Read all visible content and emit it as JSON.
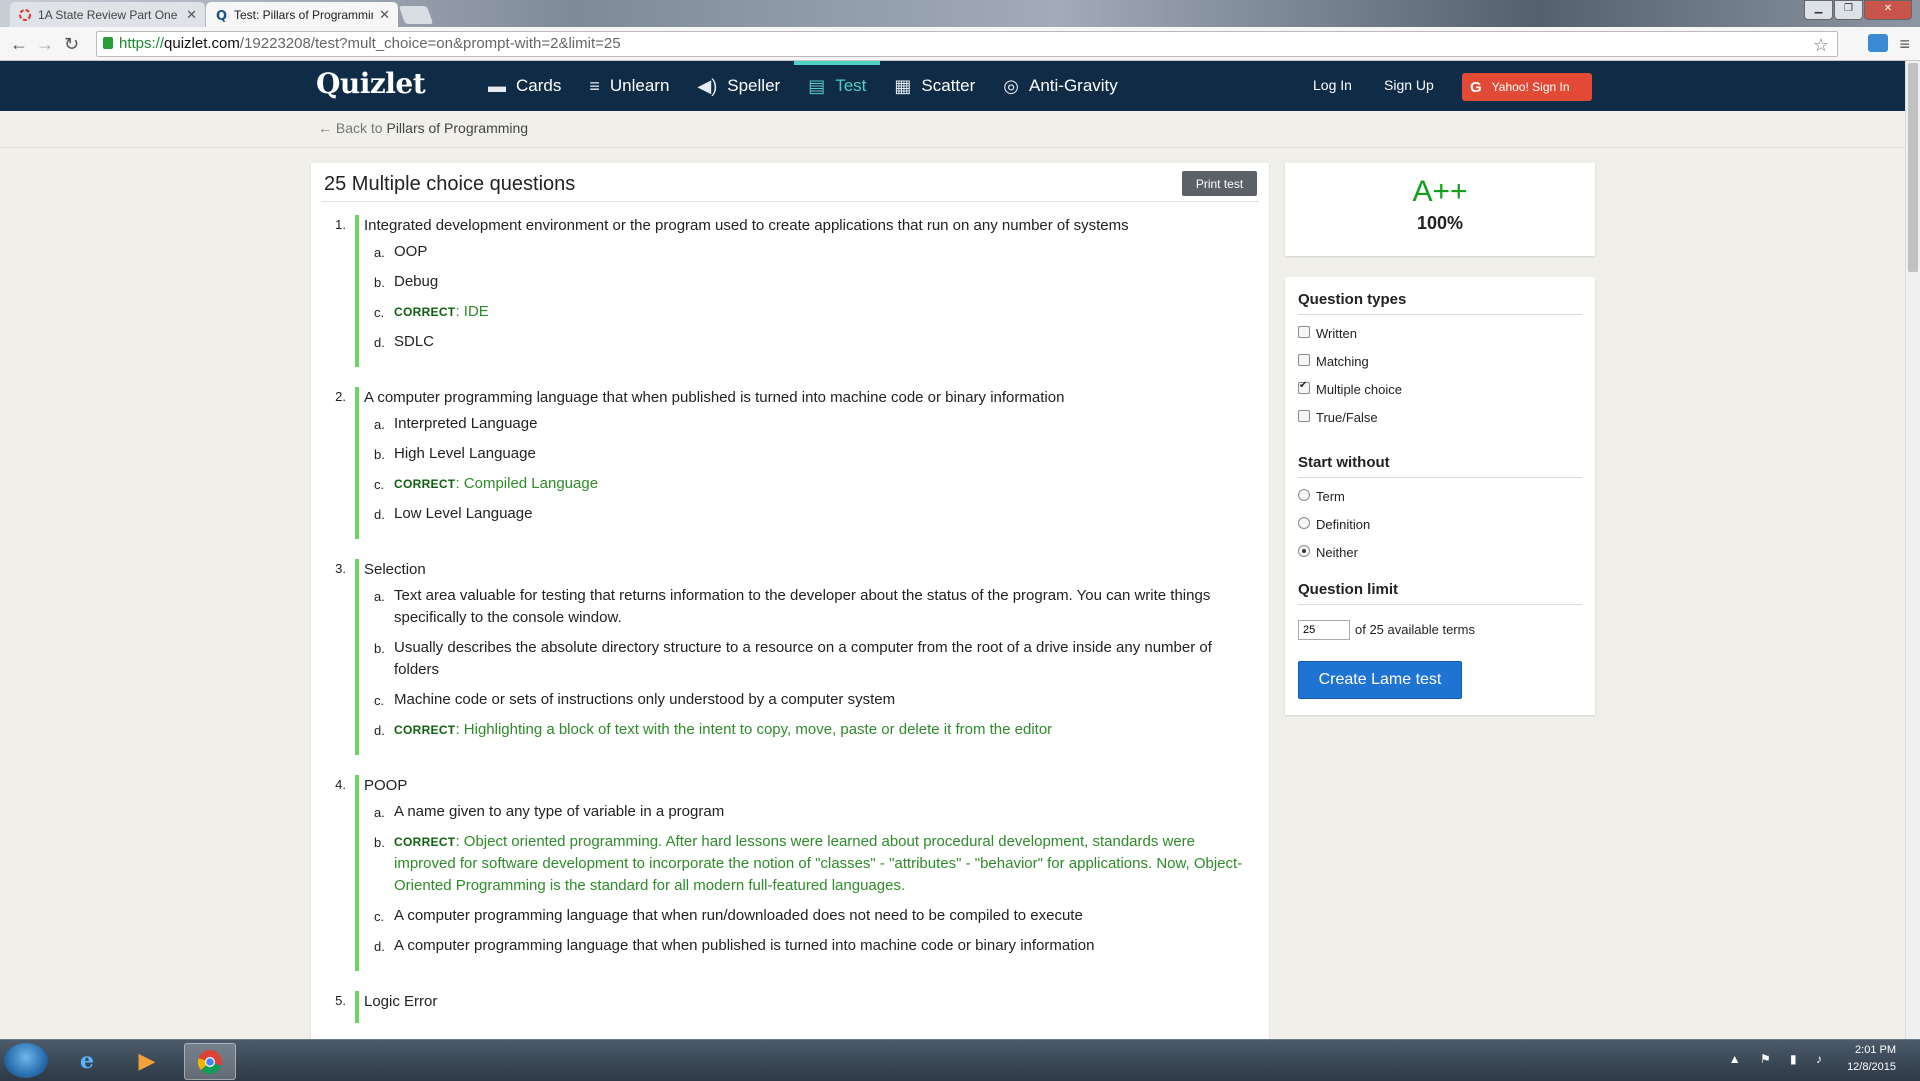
{
  "browser": {
    "tabs": [
      {
        "title": "1A State Review Part One",
        "active": false
      },
      {
        "title": "Test: Pillars of Programming",
        "active": true
      }
    ],
    "url_scheme": "https://",
    "url_host": "quizlet.com",
    "url_path": "/19223208/test?mult_choice=on&prompt-with=2&limit=25"
  },
  "header": {
    "logo": "Quizlet",
    "modes": [
      {
        "label": "Cards",
        "icon": "cards-icon",
        "glyph": "▬"
      },
      {
        "label": "Unlearn",
        "icon": "learn-icon",
        "glyph": "≡"
      },
      {
        "label": "Speller",
        "icon": "speaker-icon",
        "glyph": "◀)"
      },
      {
        "label": "Test",
        "icon": "test-icon",
        "glyph": "▤"
      },
      {
        "label": "Scatter",
        "icon": "scatter-icon",
        "glyph": "▦"
      },
      {
        "label": "Anti-Gravity",
        "icon": "planet-icon",
        "glyph": "◎"
      }
    ],
    "active_mode": "Test",
    "login": "Log In",
    "signup": "Sign Up",
    "yahoo": "Yahoo! Sign In",
    "yahoo_glyph": "G"
  },
  "subnav": {
    "back_prefix": "← Back to",
    "set_name": "Pillars of Programming"
  },
  "test": {
    "title": "25 Multiple choice questions",
    "print_label": "Print test",
    "correct_tag": "CORRECT",
    "questions": [
      {
        "num": "1.",
        "prompt": "Integrated development environment or the program used to create applications that run on any number of systems",
        "options": [
          {
            "letter": "a.",
            "text": "OOP",
            "correct": false
          },
          {
            "letter": "b.",
            "text": "Debug",
            "correct": false
          },
          {
            "letter": "c.",
            "text": "IDE",
            "correct": true
          },
          {
            "letter": "d.",
            "text": "SDLC",
            "correct": false
          }
        ]
      },
      {
        "num": "2.",
        "prompt": "A computer programming language that when published is turned into machine code or binary information",
        "options": [
          {
            "letter": "a.",
            "text": "Interpreted Language",
            "correct": false
          },
          {
            "letter": "b.",
            "text": "High Level Language",
            "correct": false
          },
          {
            "letter": "c.",
            "text": "Compiled Language",
            "correct": true
          },
          {
            "letter": "d.",
            "text": "Low Level Language",
            "correct": false
          }
        ]
      },
      {
        "num": "3.",
        "prompt": "Selection",
        "options": [
          {
            "letter": "a.",
            "text": "Text area valuable for testing that returns information to the developer about the status of the program. You can write things specifically to the console window.",
            "correct": false
          },
          {
            "letter": "b.",
            "text": "Usually describes the absolute directory structure to a resource on a computer from the root of a drive inside any number of folders",
            "correct": false
          },
          {
            "letter": "c.",
            "text": "Machine code or sets of instructions only understood by a computer system",
            "correct": false
          },
          {
            "letter": "d.",
            "text": "Highlighting a block of text with the intent to copy, move, paste or delete it from the editor",
            "correct": true
          }
        ]
      },
      {
        "num": "4.",
        "prompt": "POOP",
        "options": [
          {
            "letter": "a.",
            "text": "A name given to any type of variable in a program",
            "correct": false
          },
          {
            "letter": "b.",
            "text": "Object oriented programming. After hard lessons were learned about procedural development, standards were improved for software development to incorporate the notion of \"classes\" - \"attributes\" - \"behavior\" for applications. Now, Object-Oriented Programming is the standard for all modern full-featured languages.",
            "correct": true
          },
          {
            "letter": "c.",
            "text": "A computer programming language that when run/downloaded does not need to be compiled to execute",
            "correct": false
          },
          {
            "letter": "d.",
            "text": "A computer programming language that when published is turned into machine code or binary information",
            "correct": false
          }
        ]
      },
      {
        "num": "5.",
        "prompt": "Logic Error",
        "options": []
      }
    ]
  },
  "score": {
    "grade": "A++",
    "percent": "100%"
  },
  "options_panel": {
    "question_types_heading": "Question types",
    "question_types": [
      {
        "label": "Written",
        "checked": false
      },
      {
        "label": "Matching",
        "checked": false
      },
      {
        "label": "Multiple choice",
        "checked": true
      },
      {
        "label": "True/False",
        "checked": false
      }
    ],
    "start_without_heading": "Start without",
    "start_without": [
      {
        "label": "Term",
        "selected": false
      },
      {
        "label": "Definition",
        "selected": false
      },
      {
        "label": "Neither",
        "selected": true
      }
    ],
    "limit_heading": "Question limit",
    "limit_value": "25",
    "limit_suffix": "of 25 available terms",
    "create_label": "Create Lame test"
  },
  "taskbar": {
    "time": "2:01 PM",
    "date": "12/8/2015"
  },
  "colors": {
    "header_bg": "#0f2b46",
    "active_mode": "#4fd0c1",
    "correct_green": "#2e8b2a",
    "question_bar": "#6dd46a",
    "grade_green": "#12a01a",
    "create_button": "#1f73d3",
    "yahoo_button": "#e34a36"
  }
}
